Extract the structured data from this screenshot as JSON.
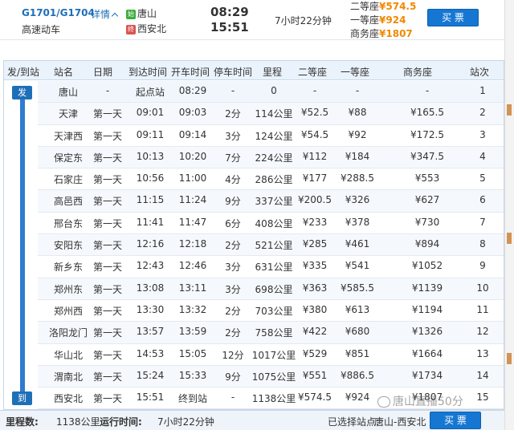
{
  "header": {
    "train_no": "G1701/G1704",
    "detail_label": "详情",
    "train_type": "高速动车",
    "from_badge": "始",
    "from_station": "唐山",
    "to_badge": "终",
    "to_station": "西安北",
    "dep_time": "08:29",
    "arr_time": "15:51",
    "duration": "7小时22分钟",
    "prices": [
      {
        "label": "二等座",
        "value": "¥574.5"
      },
      {
        "label": "一等座",
        "value": "¥924"
      },
      {
        "label": "商务座",
        "value": "¥1807"
      }
    ],
    "buy_label": "买 票"
  },
  "table": {
    "columns": [
      "发/到站",
      "站名",
      "日期",
      "到达时间",
      "开车时间",
      "停车时间",
      "里程",
      "二等座",
      "一等座",
      "商务座",
      "站次"
    ],
    "depart_tag": "发",
    "arrive_tag": "到",
    "rows": [
      [
        "唐山",
        "-",
        "起点站",
        "08:29",
        "-",
        "0",
        "-",
        "-",
        "-",
        "1"
      ],
      [
        "天津",
        "第一天",
        "09:01",
        "09:03",
        "2分",
        "114公里",
        "¥52.5",
        "¥88",
        "¥165.5",
        "2"
      ],
      [
        "天津西",
        "第一天",
        "09:11",
        "09:14",
        "3分",
        "124公里",
        "¥54.5",
        "¥92",
        "¥172.5",
        "3"
      ],
      [
        "保定东",
        "第一天",
        "10:13",
        "10:20",
        "7分",
        "224公里",
        "¥112",
        "¥184",
        "¥347.5",
        "4"
      ],
      [
        "石家庄",
        "第一天",
        "10:56",
        "11:00",
        "4分",
        "286公里",
        "¥177",
        "¥288.5",
        "¥553",
        "5"
      ],
      [
        "高邑西",
        "第一天",
        "11:15",
        "11:24",
        "9分",
        "337公里",
        "¥200.5",
        "¥326",
        "¥627",
        "6"
      ],
      [
        "邢台东",
        "第一天",
        "11:41",
        "11:47",
        "6分",
        "408公里",
        "¥233",
        "¥378",
        "¥730",
        "7"
      ],
      [
        "安阳东",
        "第一天",
        "12:16",
        "12:18",
        "2分",
        "521公里",
        "¥285",
        "¥461",
        "¥894",
        "8"
      ],
      [
        "新乡东",
        "第一天",
        "12:43",
        "12:46",
        "3分",
        "631公里",
        "¥335",
        "¥541",
        "¥1052",
        "9"
      ],
      [
        "郑州东",
        "第一天",
        "13:08",
        "13:11",
        "3分",
        "698公里",
        "¥363",
        "¥585.5",
        "¥1139",
        "10"
      ],
      [
        "郑州西",
        "第一天",
        "13:30",
        "13:32",
        "2分",
        "703公里",
        "¥380",
        "¥613",
        "¥1194",
        "11"
      ],
      [
        "洛阳龙门",
        "第一天",
        "13:57",
        "13:59",
        "2分",
        "758公里",
        "¥422",
        "¥680",
        "¥1326",
        "12"
      ],
      [
        "华山北",
        "第一天",
        "14:53",
        "15:05",
        "12分",
        "1017公里",
        "¥529",
        "¥851",
        "¥1664",
        "13"
      ],
      [
        "渭南北",
        "第一天",
        "15:24",
        "15:33",
        "9分",
        "1075公里",
        "¥551",
        "¥886.5",
        "¥1734",
        "14"
      ],
      [
        "西安北",
        "第一天",
        "15:51",
        "终到站",
        "-",
        "1138公里",
        "¥574.5",
        "¥924",
        "¥1807",
        "15"
      ]
    ]
  },
  "footer": {
    "distance_label": "里程数:",
    "distance_value": "1138公里",
    "runtime_label": "运行时间:",
    "runtime_value": "7小时22分钟",
    "selected_label": "已选择站点:",
    "selected_value": "唐山-西安北",
    "buy_label": "买 票"
  },
  "watermark": "唐山直播50分",
  "colors": {
    "accent": "#1677d2",
    "price": "#f08a00",
    "header_bg": "#eaf2fb"
  }
}
